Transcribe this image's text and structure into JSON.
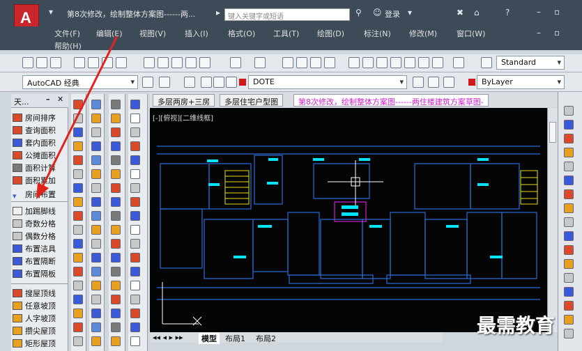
{
  "app": {
    "logo_letter": "A",
    "window_title": "第8次修改，绘制整体方案图------两...",
    "search_placeholder": "键入关键字或短语",
    "login_label": "登录",
    "help_label": "?"
  },
  "menu": {
    "items": [
      "文件(F)",
      "编辑(E)",
      "视图(V)",
      "插入(I)",
      "格式(O)",
      "工具(T)",
      "绘图(D)",
      "标注(N)",
      "修改(M)",
      "窗口(W)"
    ],
    "help": "帮助(H)"
  },
  "toolbar": {
    "text_style": "Standard",
    "workspace": "AutoCAD 经典",
    "layer": "DOTE",
    "color": "ByLayer"
  },
  "left_panel": {
    "header": "天...",
    "group1": [
      "房间排序",
      "查询面积",
      "套内面积",
      "公摊面积",
      "面积计算",
      "面积累加",
      "房间布置"
    ],
    "group2": [
      "加踢脚线",
      "奇数分格",
      "偶数分格",
      "布置洁具",
      "布置隔断",
      "布置隔板"
    ],
    "group3": [
      "搜屋顶线",
      "任意坡顶",
      "人字坡顶",
      "攒尖屋顶",
      "矩形屋顶"
    ]
  },
  "drawing": {
    "tabs": [
      "多层两房+三房",
      "多层住宅户型图",
      "第8次修改，绘制整体方案图------两住楼建筑方案草图-"
    ],
    "viewport_label": "[-][俯视][二维线框]",
    "layout_tabs": [
      "模型",
      "布局1",
      "布局2"
    ]
  },
  "watermark": "最需教育",
  "colors": {
    "titlebar": "#3d4a57",
    "canvas": "#050505",
    "wall": "#2a6bd8",
    "window": "#00e5ff",
    "stair": "#e8e01a",
    "arrow": "#e0241c",
    "active_tab_text": "#d020d0"
  }
}
